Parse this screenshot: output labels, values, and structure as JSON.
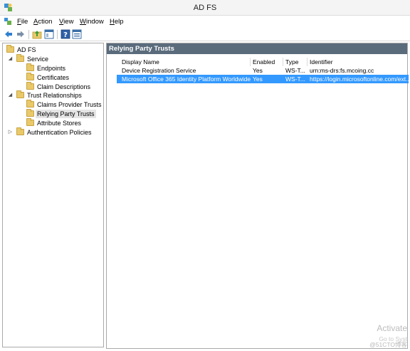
{
  "window": {
    "title": "AD FS"
  },
  "menu": {
    "items": [
      {
        "key": "F",
        "rest": "ile"
      },
      {
        "key": "A",
        "rest": "ction"
      },
      {
        "key": "V",
        "rest": "iew"
      },
      {
        "key": "W",
        "rest": "indow"
      },
      {
        "key": "H",
        "rest": "elp"
      }
    ]
  },
  "toolbar": {
    "buttons": [
      "back-arrow-icon",
      "forward-arrow-icon",
      "up-folder-icon",
      "show-hide-tree-icon",
      "help-icon",
      "properties-icon"
    ]
  },
  "tree": {
    "items": [
      {
        "label": "AD FS",
        "level": 0,
        "expander": ""
      },
      {
        "label": "Service",
        "level": 1,
        "expander": "◢"
      },
      {
        "label": "Endpoints",
        "level": 2,
        "expander": ""
      },
      {
        "label": "Certificates",
        "level": 2,
        "expander": ""
      },
      {
        "label": "Claim Descriptions",
        "level": 2,
        "expander": ""
      },
      {
        "label": "Trust Relationships",
        "level": 1,
        "expander": "◢"
      },
      {
        "label": "Claims Provider Trusts",
        "level": 2,
        "expander": ""
      },
      {
        "label": "Relying Party Trusts",
        "level": 2,
        "expander": "",
        "selected": true
      },
      {
        "label": "Attribute Stores",
        "level": 2,
        "expander": ""
      },
      {
        "label": "Authentication Policies",
        "level": 1,
        "expander": "▷"
      }
    ]
  },
  "content": {
    "header": "Relying Party Trusts",
    "columns": [
      "Display Name",
      "Enabled",
      "Type",
      "Identifier"
    ],
    "rows": [
      {
        "name": "Device Registration Service",
        "enabled": "Yes",
        "type": "WS-T...",
        "identifier": "urn:ms-drs:fs.mcoing.cc",
        "selected": false
      },
      {
        "name": "Microsoft Office 365 Identity Platform Worldwide",
        "enabled": "Yes",
        "type": "WS-T...",
        "identifier": "https://login.microsoftonline.com/ext...",
        "selected": true
      }
    ]
  },
  "watermark": {
    "line1": "Activate",
    "line2": "Go to Syst",
    "line3": "@51CTO博客"
  },
  "colors": {
    "content_header_bg": "#5a6b7c",
    "selection": "#3399ff",
    "folder": "#e9c96a"
  }
}
